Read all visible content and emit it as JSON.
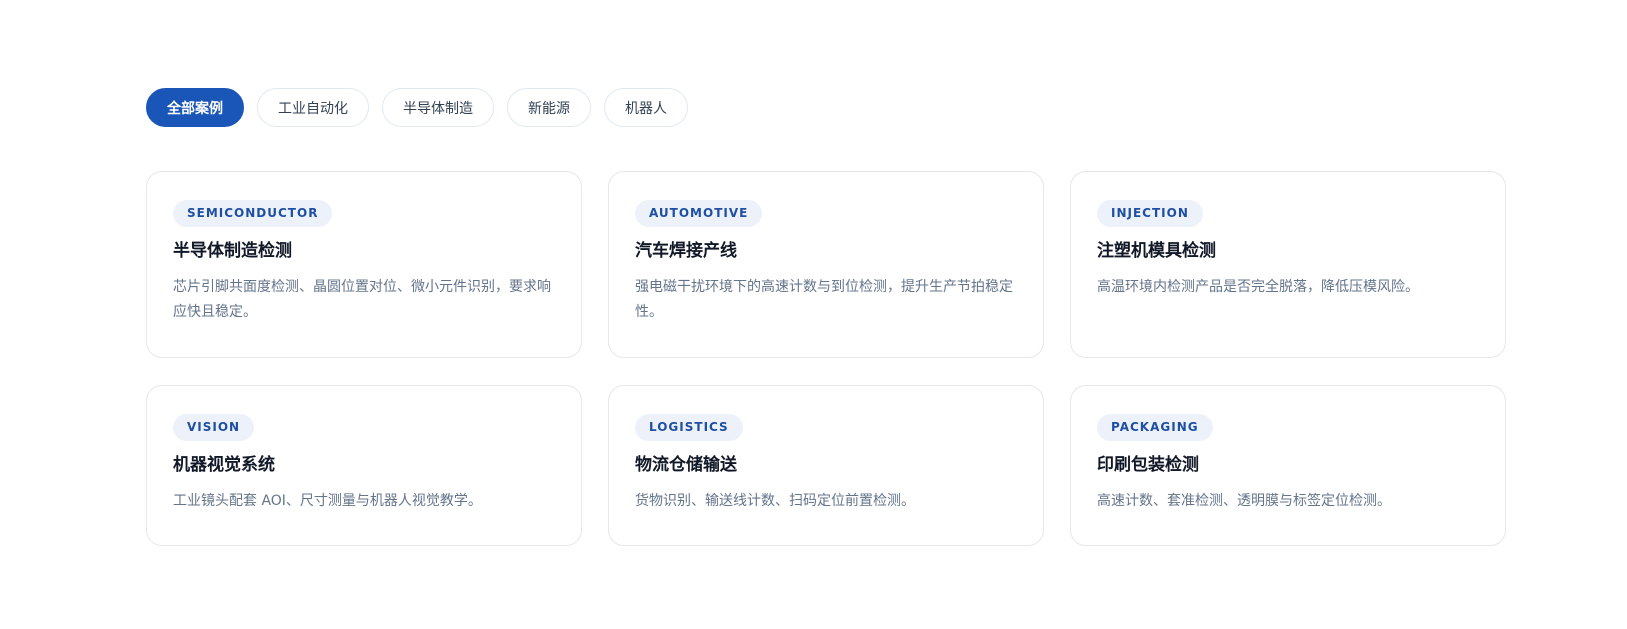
{
  "filters": [
    {
      "label": "全部案例",
      "active": true
    },
    {
      "label": "工业自动化",
      "active": false
    },
    {
      "label": "半导体制造",
      "active": false
    },
    {
      "label": "新能源",
      "active": false
    },
    {
      "label": "机器人",
      "active": false
    }
  ],
  "cards": [
    {
      "tag": "SEMICONDUCTOR",
      "title": "半导体制造检测",
      "desc": "芯片引脚共面度检测、晶圆位置对位、微小元件识别，要求响应快且稳定。"
    },
    {
      "tag": "AUTOMOTIVE",
      "title": "汽车焊接产线",
      "desc": "强电磁干扰环境下的高速计数与到位检测，提升生产节拍稳定性。"
    },
    {
      "tag": "INJECTION",
      "title": "注塑机模具检测",
      "desc": "高温环境内检测产品是否完全脱落，降低压模风险。"
    },
    {
      "tag": "VISION",
      "title": "机器视觉系统",
      "desc": "工业镜头配套 AOI、尺寸测量与机器人视觉教学。"
    },
    {
      "tag": "LOGISTICS",
      "title": "物流仓储输送",
      "desc": "货物识别、输送线计数、扫码定位前置检测。"
    },
    {
      "tag": "PACKAGING",
      "title": "印刷包装检测",
      "desc": "高速计数、套准检测、透明膜与标签定位检测。"
    }
  ],
  "colors": {
    "accent": "#1a56b8",
    "tag_bg": "#edf2fa",
    "tag_text": "#1e4fa3",
    "border": "#e5e7eb",
    "desc_text": "#64748b"
  }
}
